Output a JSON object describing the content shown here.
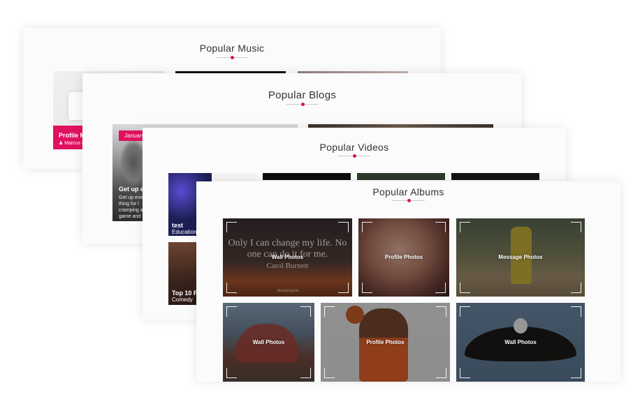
{
  "sections": {
    "music": {
      "title": "Popular Music",
      "card_title": "Profile M",
      "card_author": "Marcus Re"
    },
    "blogs": {
      "title": "Popular Blogs",
      "tag": "January",
      "post_title": "Get up e",
      "post_excerpt_1": "Get up eve",
      "post_excerpt_2": "thing for l",
      "post_excerpt_3": "cramping a",
      "post_excerpt_4": "game and"
    },
    "videos": {
      "title": "Popular Videos",
      "items": [
        {
          "title": "test",
          "category": "Education"
        },
        {
          "title": "Top 10 Fu",
          "category": "Comedy"
        }
      ]
    },
    "albums": {
      "title": "Popular Albums",
      "quote_line1": "Only I can change my life. No",
      "quote_line2": "one can do it for me.",
      "quote_author": "Carol Burnett",
      "quote_brand": "BrainyQuote",
      "items": [
        {
          "label": "Wall Photos"
        },
        {
          "label": "Profile Photos"
        },
        {
          "label": "Message Photos"
        },
        {
          "label": "Wall Photos"
        },
        {
          "label": "Profile Photos"
        },
        {
          "label": "Wall Photos"
        }
      ]
    }
  },
  "colors": {
    "accent": "#e0115f",
    "panel_bg": "#fbfbfb",
    "title_text": "#333333"
  }
}
